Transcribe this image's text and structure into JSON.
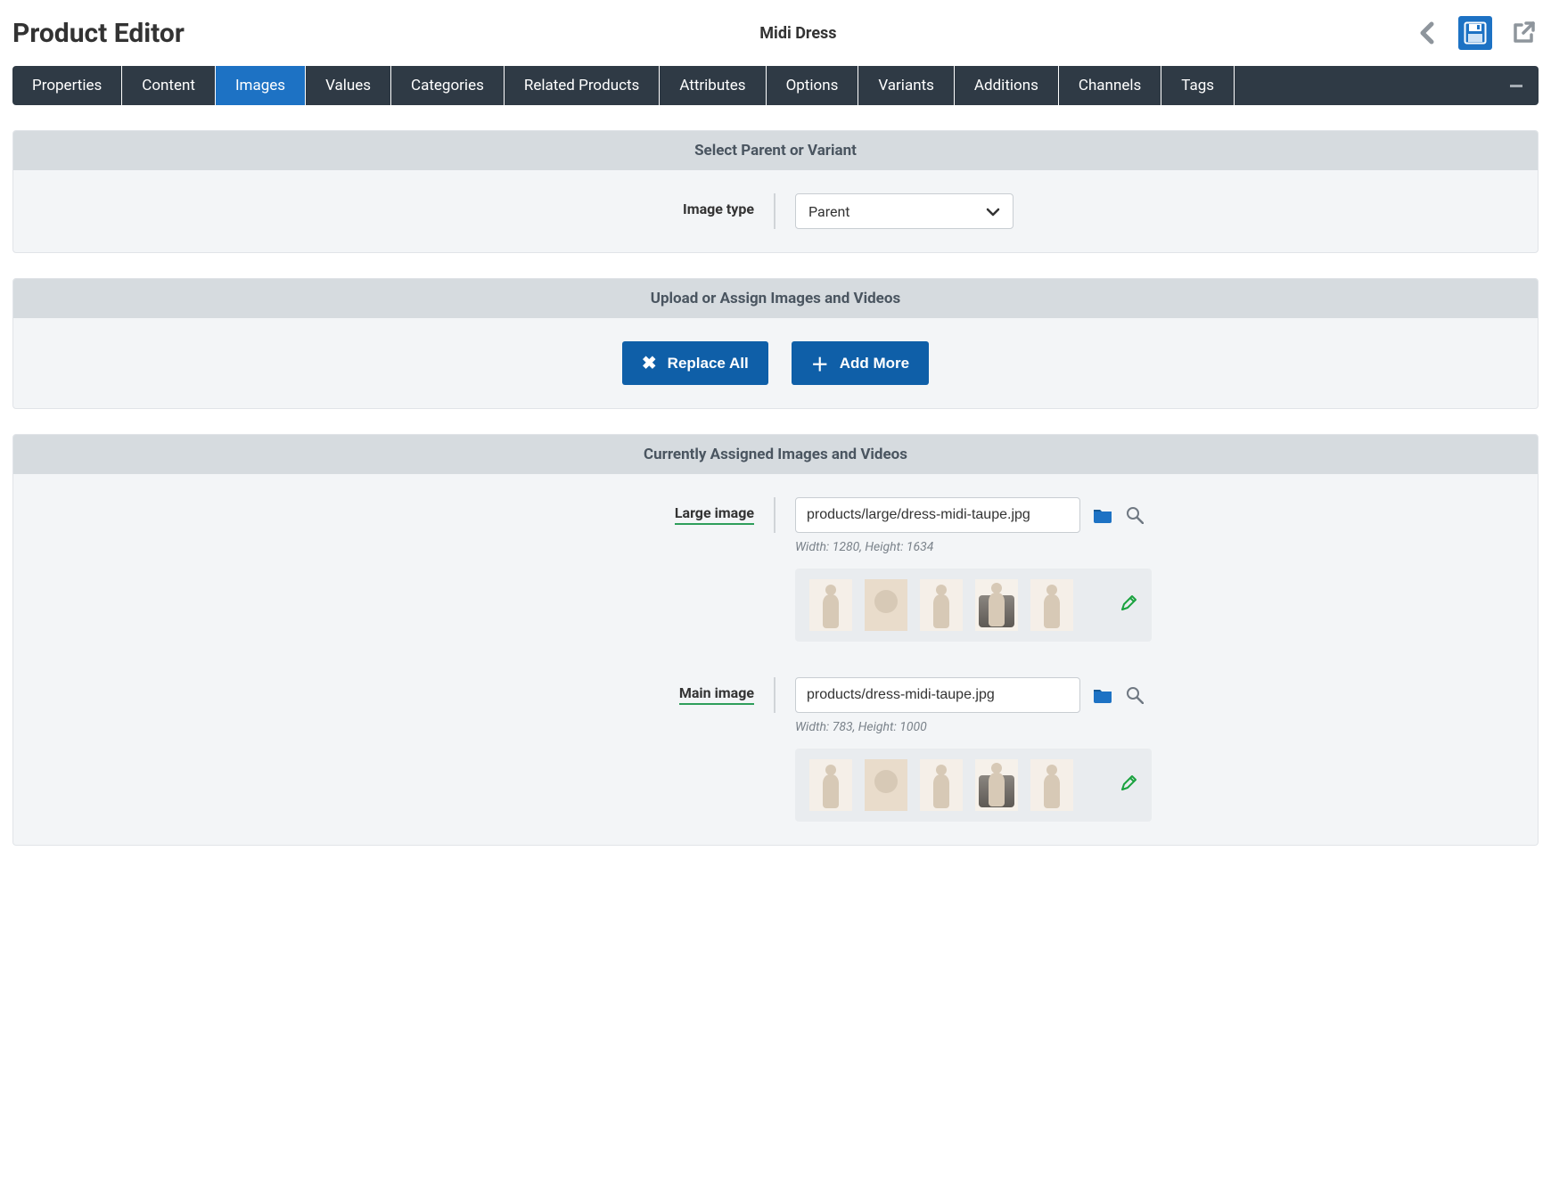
{
  "header": {
    "title": "Product Editor",
    "product_name": "Midi Dress"
  },
  "tabs": [
    {
      "label": "Properties"
    },
    {
      "label": "Content"
    },
    {
      "label": "Images",
      "active": true
    },
    {
      "label": "Values"
    },
    {
      "label": "Categories"
    },
    {
      "label": "Related Products"
    },
    {
      "label": "Attributes"
    },
    {
      "label": "Options"
    },
    {
      "label": "Variants"
    },
    {
      "label": "Additions"
    },
    {
      "label": "Channels"
    },
    {
      "label": "Tags"
    }
  ],
  "panels": {
    "parent_variant": {
      "title": "Select Parent or Variant",
      "image_type_label": "Image type",
      "image_type_value": "Parent"
    },
    "upload": {
      "title": "Upload or Assign Images and Videos",
      "replace_all": "Replace All",
      "add_more": "Add More"
    },
    "assigned": {
      "title": "Currently Assigned Images and Videos",
      "items": [
        {
          "label": "Large image",
          "path": "products/large/dress-midi-taupe.jpg",
          "dims": "Width: 1280, Height: 1634"
        },
        {
          "label": "Main image",
          "path": "products/dress-midi-taupe.jpg",
          "dims": "Width: 783, Height: 1000"
        }
      ]
    }
  }
}
